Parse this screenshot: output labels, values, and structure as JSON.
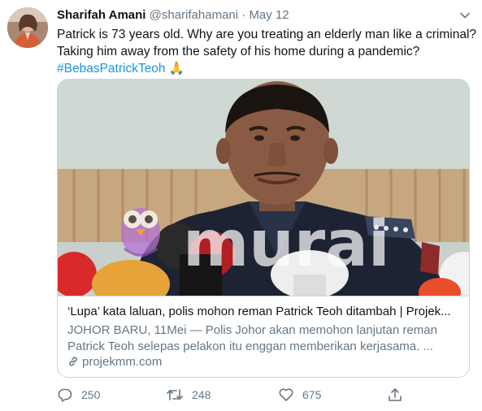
{
  "tweet": {
    "author_name": "Sharifah Amani",
    "handle": "@sharifahamani",
    "separator": " · ",
    "date": "May 12",
    "text_line1": "Patrick is 73 years old. Why are you treating an elderly man like a criminal?",
    "text_line2": "Taking him away from the safety of his home during a pandemic?",
    "hashtag": "#BebasPatrickTeoh",
    "emoji": "🙏"
  },
  "card": {
    "watermark": "murai",
    "title": "‘Lupa’ kata laluan, polis mohon reman Patrick Teoh ditambah | Projek...",
    "description_line1": "JOHOR BARU, 11Mei — Polis Johor akan memohon lanjutan reman",
    "description_line2": "Patrick Teoh selepas pelakon itu enggan memberikan kerjasama.  ...",
    "domain": "projekmm.com"
  },
  "actions": {
    "replies": "250",
    "retweets": "248",
    "likes": "675"
  },
  "icons": [
    "caret-down-icon",
    "reply-icon",
    "retweet-icon",
    "like-icon",
    "share-icon",
    "link-icon"
  ],
  "colors": {
    "hashtag": "#1b95e0",
    "secondary_text": "#657786",
    "card_border": "#ccd6dd"
  }
}
